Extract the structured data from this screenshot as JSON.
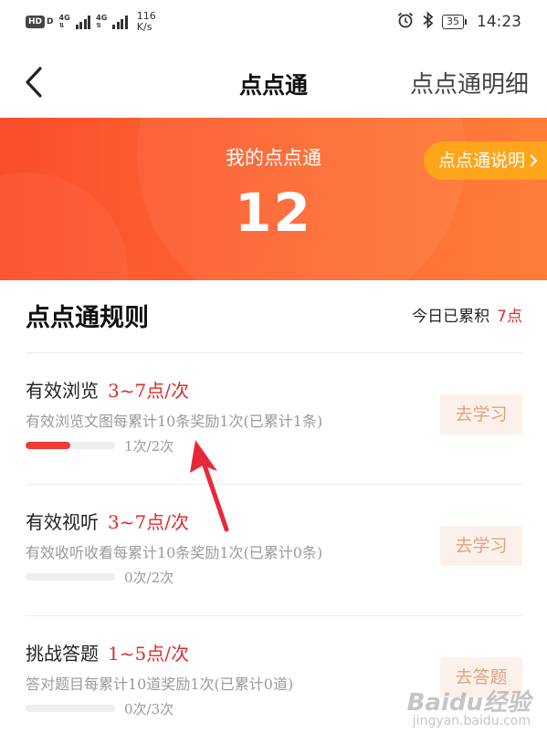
{
  "status_bar": {
    "hd": "HD",
    "d": "D",
    "sim1": "4G",
    "sim2": "4G",
    "speed_value": "116",
    "speed_unit": "K/s",
    "battery": "35",
    "time": "14:23",
    "alarm_icon": "alarm-icon",
    "bluetooth_icon": "bluetooth-icon"
  },
  "nav": {
    "title": "点点通",
    "detail_link": "点点通明细",
    "back_icon": "chevron-left-icon"
  },
  "banner": {
    "label": "我的点点通",
    "value": "12",
    "explain_button": "点点通说明",
    "explain_icon": "chevron-right-icon"
  },
  "rules": {
    "title": "点点通规则",
    "today_label": "今日已累积",
    "today_value": "7点",
    "items": [
      {
        "name": "有效浏览",
        "points": "3~7点/次",
        "desc": "有效浏览文图每累计10条奖励1次(已累计1条)",
        "progress_text": "1次/2次",
        "progress": 0.5,
        "action": "去学习"
      },
      {
        "name": "有效视听",
        "points": "3~7点/次",
        "desc": "有效收听收看每累计10条奖励1次(已累计0条)",
        "progress_text": "0次/2次",
        "progress": 0,
        "action": "去学习"
      },
      {
        "name": "挑战答题",
        "points": "1~5点/次",
        "desc": "答对题目每累计10道奖励1次(已累计0道)",
        "progress_text": "0次/3次",
        "progress": 0,
        "action": "去答题"
      }
    ]
  },
  "watermark": {
    "brand": "Baidu经验",
    "site": "jingyan.baidu.com"
  },
  "colors": {
    "banner_start": "#fb4d2c",
    "banner_end": "#fe7d38",
    "accent_red": "#e02a2a",
    "explain_button_bg": "#ffa51c",
    "action_button_bg": "#fcf1ea",
    "action_button_text": "#e0a27e"
  }
}
